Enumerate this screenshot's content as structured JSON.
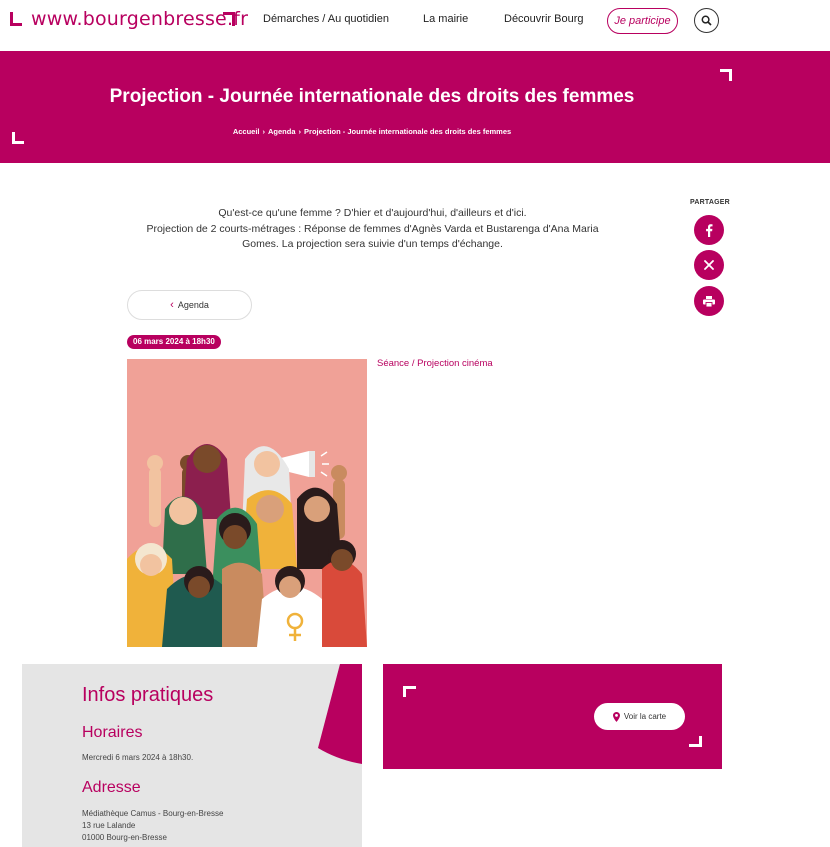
{
  "header": {
    "logo_text": "www.bourgenbresse.fr",
    "nav": [
      "Démarches / Au quotidien",
      "La mairie",
      "Découvrir Bourg"
    ],
    "participe": "Je participe"
  },
  "banner": {
    "title": "Projection - Journée internationale des droits des femmes",
    "breadcrumb": [
      "Accueil",
      "Agenda",
      "Projection - Journée internationale des droits des femmes"
    ]
  },
  "intro": {
    "line1": "Qu'est-ce qu'une femme ? D'hier et d'aujourd'hui, d'ailleurs et d'ici.",
    "line2": "Projection de 2 courts-métrages : Réponse de femmes d'Agnès Varda et Bustarenga d'Ana Maria",
    "line3": "Gomes. La projection sera suivie d'un temps d'échange."
  },
  "share": {
    "label": "PARTAGER"
  },
  "back_label": "Agenda",
  "date_badge": "06 mars 2024 à 18h30",
  "category": "Séance / Projection cinéma",
  "info": {
    "title": "Infos pratiques",
    "hours_title": "Horaires",
    "hours_text": "Mercredi 6 mars 2024 à 18h30.",
    "address_title": "Adresse",
    "address_lines": [
      "Médiathèque Camus - Bourg-en-Bresse",
      "13 rue Lalande",
      "01000 Bourg-en-Bresse"
    ]
  },
  "map": {
    "button_label": "Voir la carte"
  },
  "colors": {
    "brand": "#b8005f",
    "panel": "#e5e5e5",
    "image_bg": "#f0a197"
  }
}
